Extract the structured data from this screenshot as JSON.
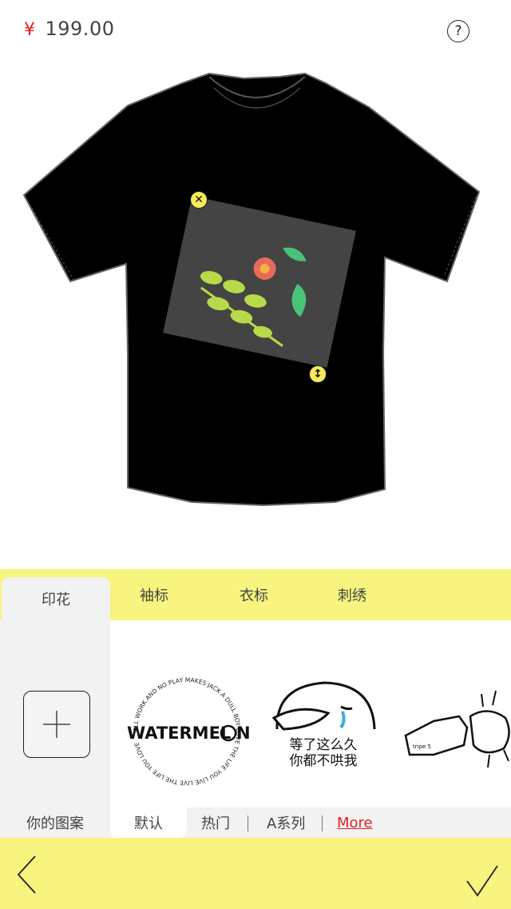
{
  "header": {
    "currency": "¥",
    "price": "199.00",
    "help_symbol": "?"
  },
  "editor": {
    "delete_symbol": "✕",
    "resize_symbol": "↕"
  },
  "tabs": [
    {
      "label": "印花",
      "active": true
    },
    {
      "label": "袖标",
      "active": false
    },
    {
      "label": "衣标",
      "active": false
    },
    {
      "label": "刺绣",
      "active": false
    }
  ],
  "left_panel": {
    "your_designs_label": "你的图案"
  },
  "thumbnails": {
    "watermelon": {
      "word": "WATERMEL",
      "word_end": "N",
      "ring_text": "ALL WORK AND NO PLAY MAKES JACK A DULL BOY LOVE THE LIFE YOU LIVE LIVE THE LIFE YOU LOVE"
    },
    "sticker_line1": "等了这么久",
    "sticker_line2": "你都不哄我",
    "fist_text": "tripe 5"
  },
  "categories": [
    {
      "label": "默认",
      "active": true
    },
    {
      "label": "热门",
      "active": false
    },
    {
      "label": "A系列",
      "active": false
    },
    {
      "label": "More",
      "active": false
    }
  ],
  "colors": {
    "accent_yellow": "#f7f47f",
    "price_red": "#e02020",
    "shirt": "#000000"
  }
}
